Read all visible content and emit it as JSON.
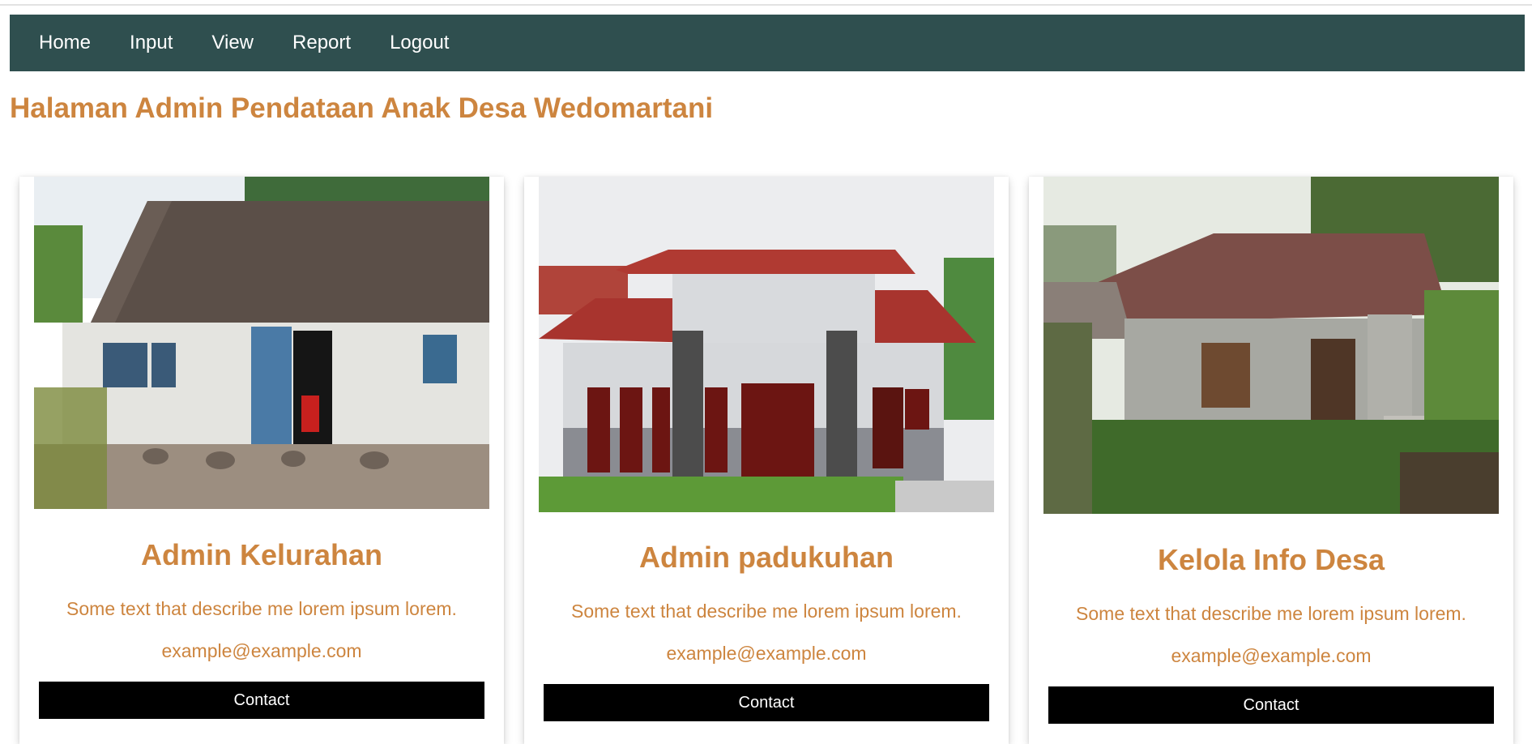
{
  "nav": {
    "items": [
      {
        "label": "Home"
      },
      {
        "label": "Input"
      },
      {
        "label": "View"
      },
      {
        "label": "Report"
      },
      {
        "label": "Logout"
      }
    ]
  },
  "page_title": "Halaman Admin Pendataan Anak Desa Wedomartani",
  "cards": [
    {
      "image": "old-village-house-photo",
      "title": "Admin Kelurahan",
      "description": "Some text that describe me lorem ipsum lorem.",
      "email": "example@example.com",
      "button_label": "Contact"
    },
    {
      "image": "modern-house-photo",
      "title": "Admin padukuhan",
      "description": "Some text that describe me lorem ipsum lorem.",
      "email": "example@example.com",
      "button_label": "Contact"
    },
    {
      "image": "rural-house-photo",
      "title": "Kelola Info Desa",
      "description": "Some text that describe me lorem ipsum lorem.",
      "email": "example@example.com",
      "button_label": "Contact"
    }
  ],
  "colors": {
    "navbar": "#2f4f4f",
    "accent": "#cd853f",
    "button": "#000000"
  }
}
